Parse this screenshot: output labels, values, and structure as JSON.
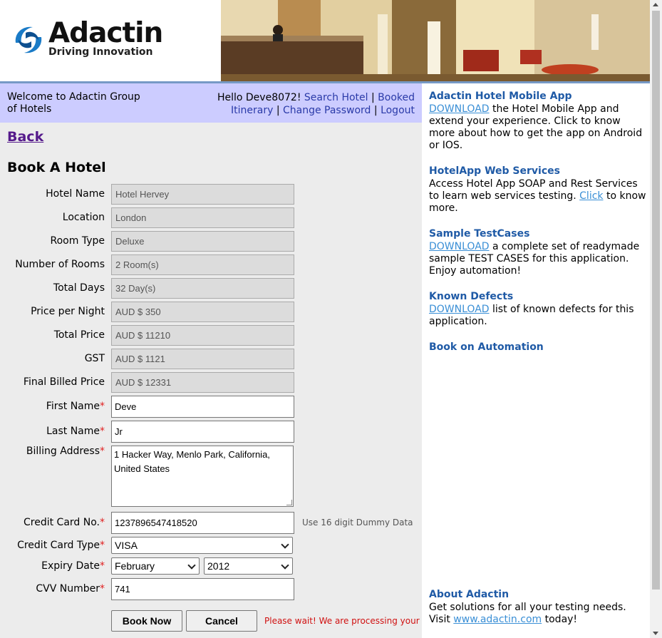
{
  "header": {
    "logo_title": "Adactin",
    "logo_tagline": "Driving Innovation"
  },
  "welcome": {
    "text": "Welcome to Adactin Group of Hotels"
  },
  "nav": {
    "greeting": "Hello Deve8072!",
    "search_hotel": "Search Hotel",
    "booked_itinerary_1": "Booked",
    "booked_itinerary_2": "Itinerary",
    "change_password": "Change Password",
    "logout": "Logout",
    "separator": "|"
  },
  "back_link": "Back",
  "page_title": "Book A Hotel",
  "form": {
    "hotel_name": {
      "label": "Hotel Name",
      "value": "Hotel Hervey"
    },
    "location": {
      "label": "Location",
      "value": "London"
    },
    "room_type": {
      "label": "Room Type",
      "value": "Deluxe"
    },
    "number_of_rooms": {
      "label": "Number of Rooms",
      "value": "2 Room(s)"
    },
    "total_days": {
      "label": "Total Days",
      "value": "32 Day(s)"
    },
    "price_per_night": {
      "label": "Price per Night",
      "value": "AUD $ 350"
    },
    "total_price": {
      "label": "Total Price",
      "value": "AUD $ 11210"
    },
    "gst": {
      "label": "GST",
      "value": "AUD $ 1121"
    },
    "final_billed_price": {
      "label": "Final Billed Price",
      "value": "AUD $ 12331"
    },
    "first_name": {
      "label": "First Name",
      "value": "Deve"
    },
    "last_name": {
      "label": "Last Name",
      "value": "Jr"
    },
    "billing_address": {
      "label": "Billing Address",
      "line1": "1 Hacker Way, Menlo Park, California,",
      "line2": "United States"
    },
    "credit_card_no": {
      "label": "Credit Card No.",
      "value": "1237896547418520",
      "hint": "Use 16 digit Dummy Data"
    },
    "credit_card_type": {
      "label": "Credit Card Type",
      "value": "VISA"
    },
    "expiry_date": {
      "label": "Expiry Date",
      "month": "February",
      "year": "2012"
    },
    "cvv_number": {
      "label": "CVV Number",
      "value": "741"
    },
    "required_marker": "*"
  },
  "buttons": {
    "book_now": "Book Now",
    "cancel": "Cancel",
    "wait_message": "Please wait! We are processing your"
  },
  "sidebar": {
    "mobile_app": {
      "heading": "Adactin Hotel Mobile App",
      "link": "DOWNLOAD",
      "text": "the Hotel Mobile App and extend your experience. Click to know more about how to get the app on Android or IOS."
    },
    "web_services": {
      "heading": "HotelApp Web Services",
      "text_before": "Access Hotel App SOAP and Rest Services to learn web services testing.",
      "link": "Click",
      "text_after": "to know more."
    },
    "test_cases": {
      "heading": "Sample TestCases",
      "link": "DOWNLOAD",
      "text": "a complete set of readymade sample TEST CASES for this application. Enjoy automation!"
    },
    "known_defects": {
      "heading": "Known Defects",
      "link": "DOWNLOAD",
      "text": "list of known defects for this application."
    },
    "book_on_automation": {
      "heading": "Book on Automation"
    },
    "about": {
      "heading": "About Adactin",
      "text1": "Get solutions for all your testing needs.",
      "visit": "Visit",
      "link": "www.adactin.com",
      "text2": "today!"
    }
  }
}
